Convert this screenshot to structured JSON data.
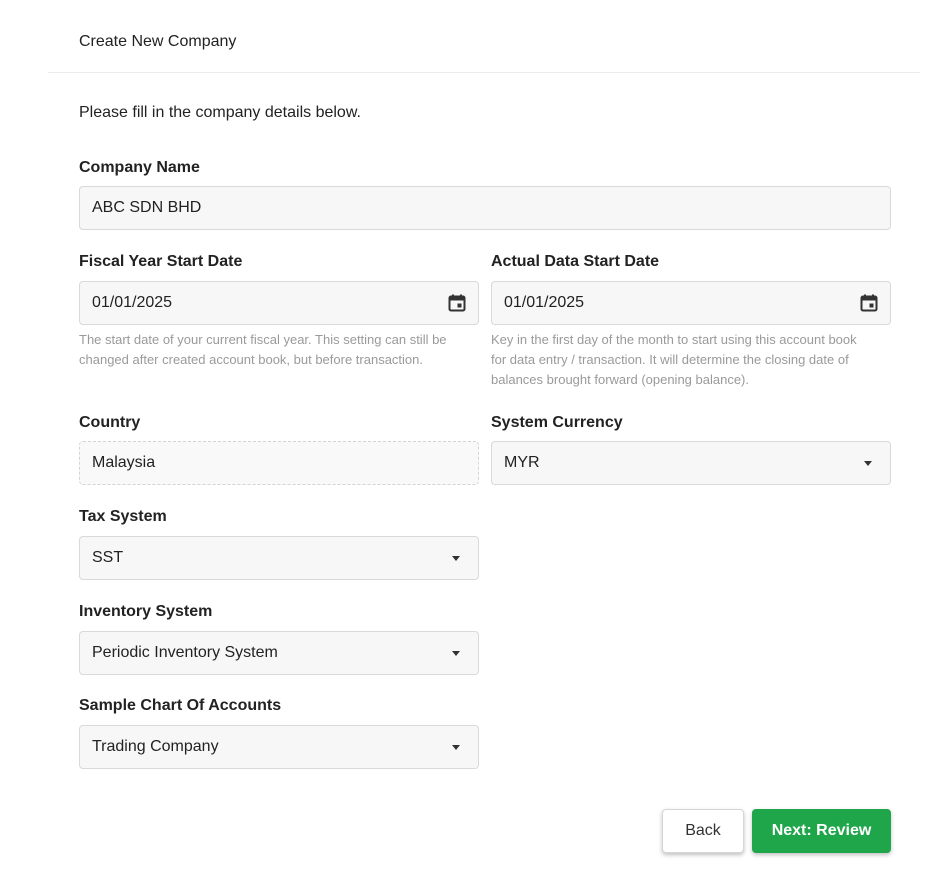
{
  "header": {
    "title": "Create New Company"
  },
  "intro": "Please fill in the company details below.",
  "company_name": {
    "label": "Company Name",
    "value": "ABC SDN BHD"
  },
  "fiscal_year": {
    "label": "Fiscal Year Start Date",
    "value": "01/01/2025",
    "help_lines": [
      "The start date of your current fiscal year. This setting can still be",
      "changed after created account book, but before transaction."
    ]
  },
  "actual_data": {
    "label": "Actual Data Start Date",
    "value": "01/01/2025",
    "help_lines": [
      "Key in the first day of the month to start using this account book",
      "for data entry / transaction. It will determine the closing date of",
      "balances brought forward (opening balance)."
    ]
  },
  "country": {
    "label": "Country",
    "value": "Malaysia"
  },
  "currency": {
    "label": "System Currency",
    "value": "MYR"
  },
  "tax_system": {
    "label": "Tax System",
    "value": "SST"
  },
  "inventory_system": {
    "label": "Inventory System",
    "value": "Periodic Inventory System"
  },
  "chart_of_accounts": {
    "label": "Sample Chart Of Accounts",
    "value": "Trading Company"
  },
  "buttons": {
    "back": "Back",
    "next": "Next: Review"
  },
  "colors": {
    "primary": "#1fa54a",
    "field_bg": "#f7f7f7",
    "border": "#d9d9d9",
    "help_text": "#9a9a9a"
  },
  "icons": {
    "date_picker": "calendar-icon",
    "select": "caret-down-icon"
  }
}
